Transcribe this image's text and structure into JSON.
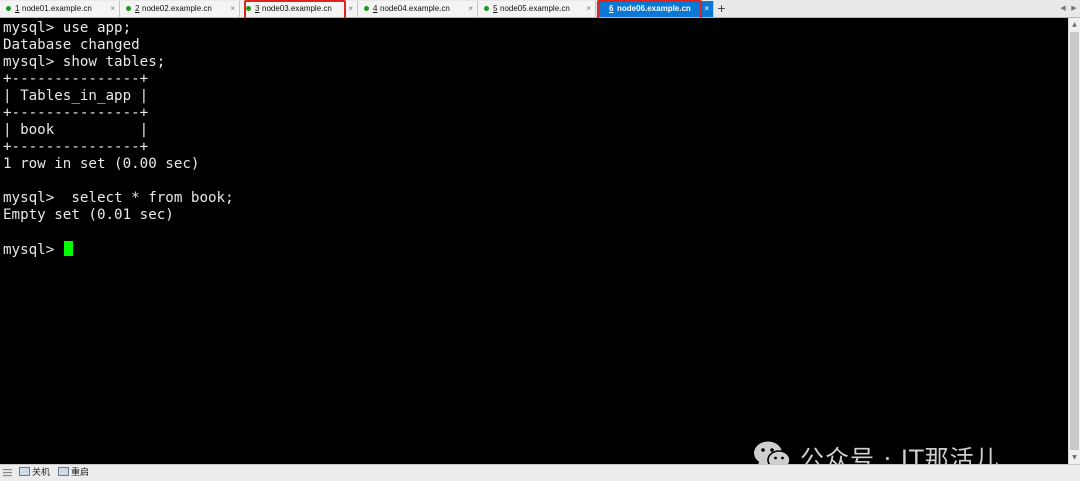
{
  "tabs": [
    {
      "num": "1",
      "name": "node01.example.cn",
      "dot_color": "#1a9b1a",
      "active": false
    },
    {
      "num": "2",
      "name": "node02.example.cn",
      "dot_color": "#1a9b1a",
      "active": false
    },
    {
      "num": "3",
      "name": "node03.example.cn",
      "dot_color": "#1a9b1a",
      "active": false
    },
    {
      "num": "4",
      "name": "node04.example.cn",
      "dot_color": "#1a9b1a",
      "active": false
    },
    {
      "num": "5",
      "name": "node05.example.cn",
      "dot_color": "#1a9b1a",
      "active": false
    },
    {
      "num": "6",
      "name": "node06.example.cn",
      "active": true
    }
  ],
  "tab_close_glyph": "×",
  "add_tab_glyph": "+",
  "terminal": {
    "lines": [
      "mysql> use app;",
      "Database changed",
      "mysql> show tables;",
      "+---------------+",
      "| Tables_in_app |",
      "+---------------+",
      "| book          |",
      "+---------------+",
      "1 row in set (0.00 sec)",
      "",
      "mysql>  select * from book;",
      "Empty set (0.01 sec)",
      "",
      "mysql> "
    ],
    "cursor_color": "#00ff00",
    "text_color": "#e8e8e8",
    "background": "#000000"
  },
  "highlight_color": "#e0231f",
  "active_tab_color": "#0a78d4",
  "watermark": {
    "text": "公众号 · IT那活儿",
    "icon": "wechat-icon"
  },
  "statusbar": {
    "shutdown_label": "关机",
    "restart_label": "重启",
    "icons": [
      "grip-icon",
      "shutdown-icon",
      "restart-icon"
    ]
  }
}
